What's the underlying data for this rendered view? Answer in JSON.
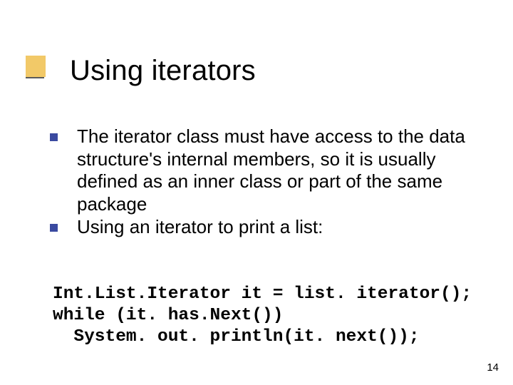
{
  "title": "Using iterators",
  "bullets": [
    "The iterator class must have access to the data structure's internal members, so it is usually defined as an inner class or part of the same package",
    "Using an iterator to print a list:"
  ],
  "code": [
    "Int.List.Iterator it = list. iterator();",
    "while (it. has.Next())",
    "  System. out. println(it. next());"
  ],
  "slide_number": "14"
}
